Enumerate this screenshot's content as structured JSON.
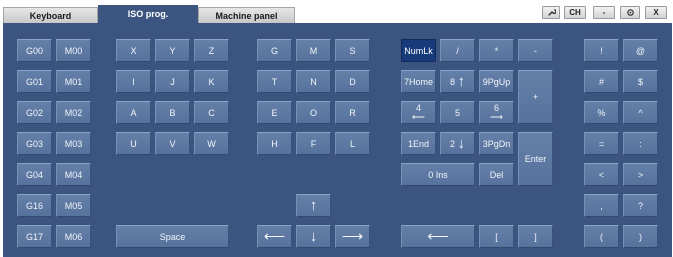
{
  "tabs": [
    {
      "label": "Keyboard",
      "active": false
    },
    {
      "label": "ISO prog.",
      "active": true
    },
    {
      "label": "Machine panel",
      "active": false
    }
  ],
  "window_buttons": {
    "tool_icon": "wrench-icon",
    "lang": "CH",
    "minimize": "-",
    "settings_icon": "gear-icon",
    "close": "X"
  },
  "keys": {
    "g00": "G00",
    "g01": "G01",
    "g02": "G02",
    "g03": "G03",
    "g04": "G04",
    "g16": "G16",
    "g17": "G17",
    "m00": "M00",
    "m01": "M01",
    "m02": "M02",
    "m03": "M03",
    "m04": "M04",
    "m05": "M05",
    "m06": "M06",
    "x": "X",
    "y": "Y",
    "z": "Z",
    "i": "I",
    "j": "J",
    "k": "K",
    "a": "A",
    "b": "B",
    "c": "C",
    "u": "U",
    "v": "V",
    "w": "W",
    "space": "Space",
    "g": "G",
    "m": "M",
    "s": "S",
    "t": "T",
    "n": "N",
    "d": "D",
    "e": "E",
    "o": "O",
    "r": "R",
    "h": "H",
    "f": "F",
    "l": "L",
    "up": "↑",
    "down": "↓",
    "left": "⟵",
    "right": "⟶",
    "numlk": "NumLk",
    "slash": "/",
    "star": "*",
    "minus": "-",
    "seven": "7Home",
    "eight": "8",
    "eight_arrow": "↑",
    "nine": "9PgUp",
    "plus": "+",
    "four": "4",
    "four_arrow": "⟵",
    "five": "5",
    "six": "6",
    "six_arrow": "⟶",
    "one": "1End",
    "two": "2",
    "two_arrow": "↓",
    "three": "3PgDn",
    "enter": "Enter",
    "zero": "0 Ins",
    "del": "Del",
    "backspace": "⟵",
    "lbracket": "[",
    "rbracket": "]",
    "excl": "!",
    "at": "@",
    "hash": "#",
    "dollar": "$",
    "percent": "%",
    "caret": "^",
    "equals": "=",
    "colon": ":",
    "lt": "<",
    "gt": ">",
    "comma": ",",
    "question": "?",
    "lparen": "(",
    "rparen": ")"
  },
  "colors": {
    "panel": "#3b5580",
    "key": "#5d79a3",
    "key_active": "#163a7a"
  }
}
